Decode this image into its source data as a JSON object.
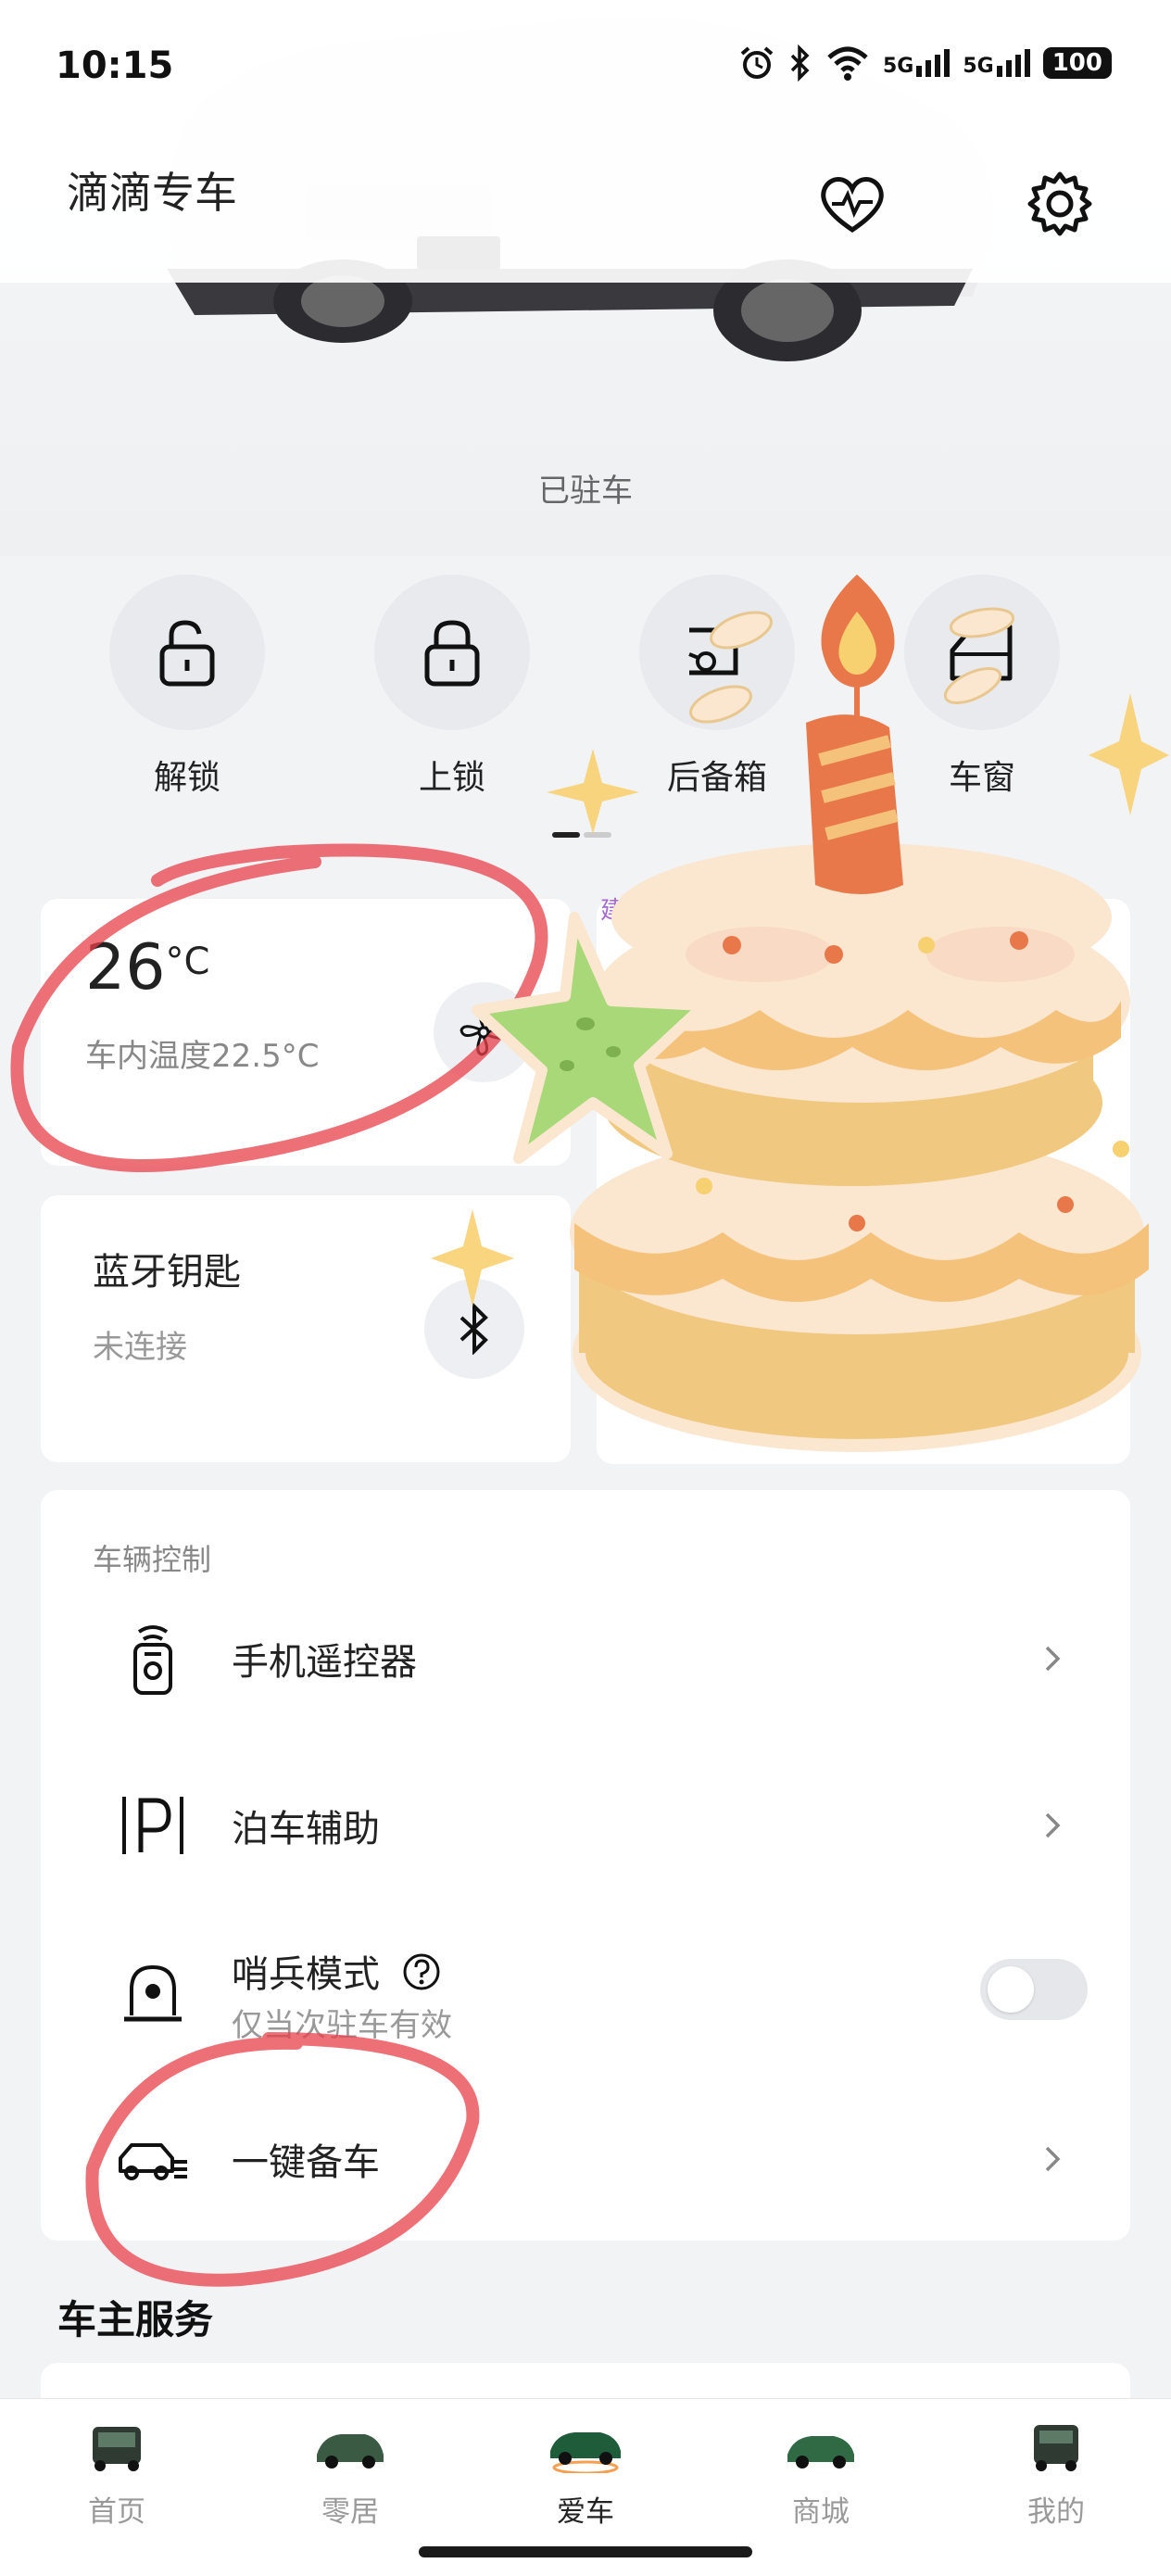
{
  "status_bar": {
    "time": "10:15",
    "network_1": "5G",
    "network_2": "5G",
    "battery": "100"
  },
  "header": {
    "title": "滴滴专车"
  },
  "car": {
    "status": "已驻车"
  },
  "quick_controls": [
    {
      "label": "解锁"
    },
    {
      "label": "上锁"
    },
    {
      "label": "后备箱"
    },
    {
      "label": "车窗"
    }
  ],
  "climate": {
    "temperature": "26",
    "unit": "°C",
    "inner": "车内温度22.5°C"
  },
  "bluetooth_key": {
    "title": "蓝牙钥匙",
    "status": "未连接"
  },
  "partial_tag": "建",
  "vehicle_control": {
    "heading": "车辆控制",
    "items": [
      {
        "label": "手机遥控器"
      },
      {
        "label": "泊车辅助"
      },
      {
        "label": "哨兵模式",
        "sub": "仅当次驻车有效",
        "toggle": false
      },
      {
        "label": "一键备车"
      }
    ]
  },
  "owner_services": {
    "title": "车主服务"
  },
  "bottom_nav": [
    {
      "label": "首页",
      "active": false
    },
    {
      "label": "零居",
      "active": false
    },
    {
      "label": "爱车",
      "active": true
    },
    {
      "label": "商城",
      "active": false
    },
    {
      "label": "我的",
      "active": false
    }
  ],
  "colors": {
    "accent_green": "#1f5c3a",
    "annotation_red": "#e8404a",
    "cake_frosting": "#fbe6cf",
    "cake_candle": "#e8784a",
    "star_green": "#a8d878",
    "sparkle_yellow": "#f7d070"
  }
}
